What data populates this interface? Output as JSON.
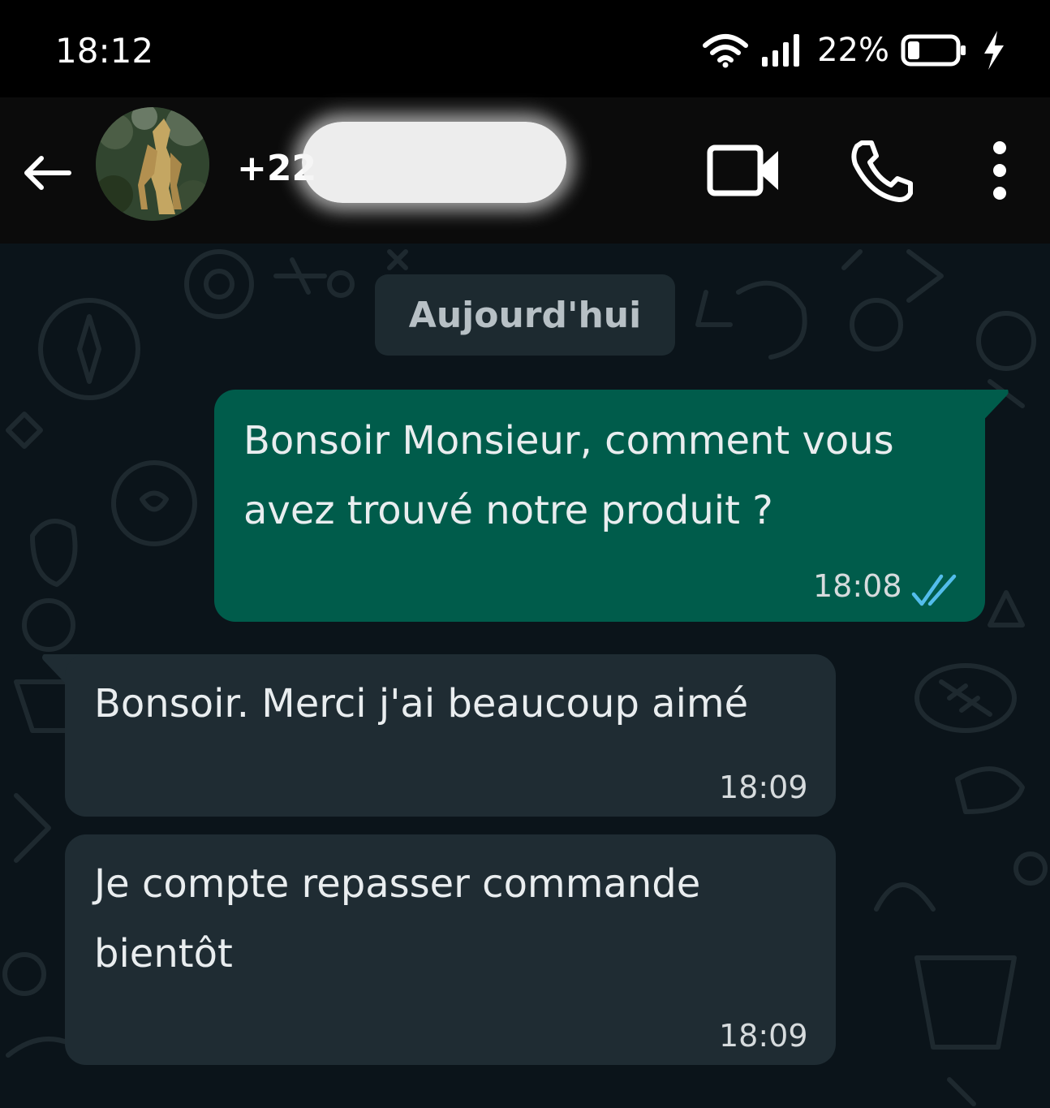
{
  "status_bar": {
    "time": "18:12",
    "battery": "22%"
  },
  "header": {
    "contact_prefix": "+22"
  },
  "chat": {
    "date_chip": "Aujourd'hui",
    "messages": [
      {
        "direction": "outgoing",
        "text_lines": [
          "Bonsoir Monsieur, comment vous",
          "avez trouvé notre produit ?"
        ],
        "time": "18:08",
        "read": true
      },
      {
        "direction": "incoming",
        "text_lines": [
          "Bonsoir. Merci j'ai beaucoup aimé"
        ],
        "time": "18:09"
      },
      {
        "direction": "incoming",
        "text_lines": [
          "Je compte repasser commande",
          "bientôt"
        ],
        "time": "18:09"
      }
    ]
  },
  "colors": {
    "outgoing_bubble": "#005c4b",
    "incoming_bubble": "#1f2c33",
    "chat_background": "#0b141a",
    "read_ticks": "#53bdeb"
  }
}
